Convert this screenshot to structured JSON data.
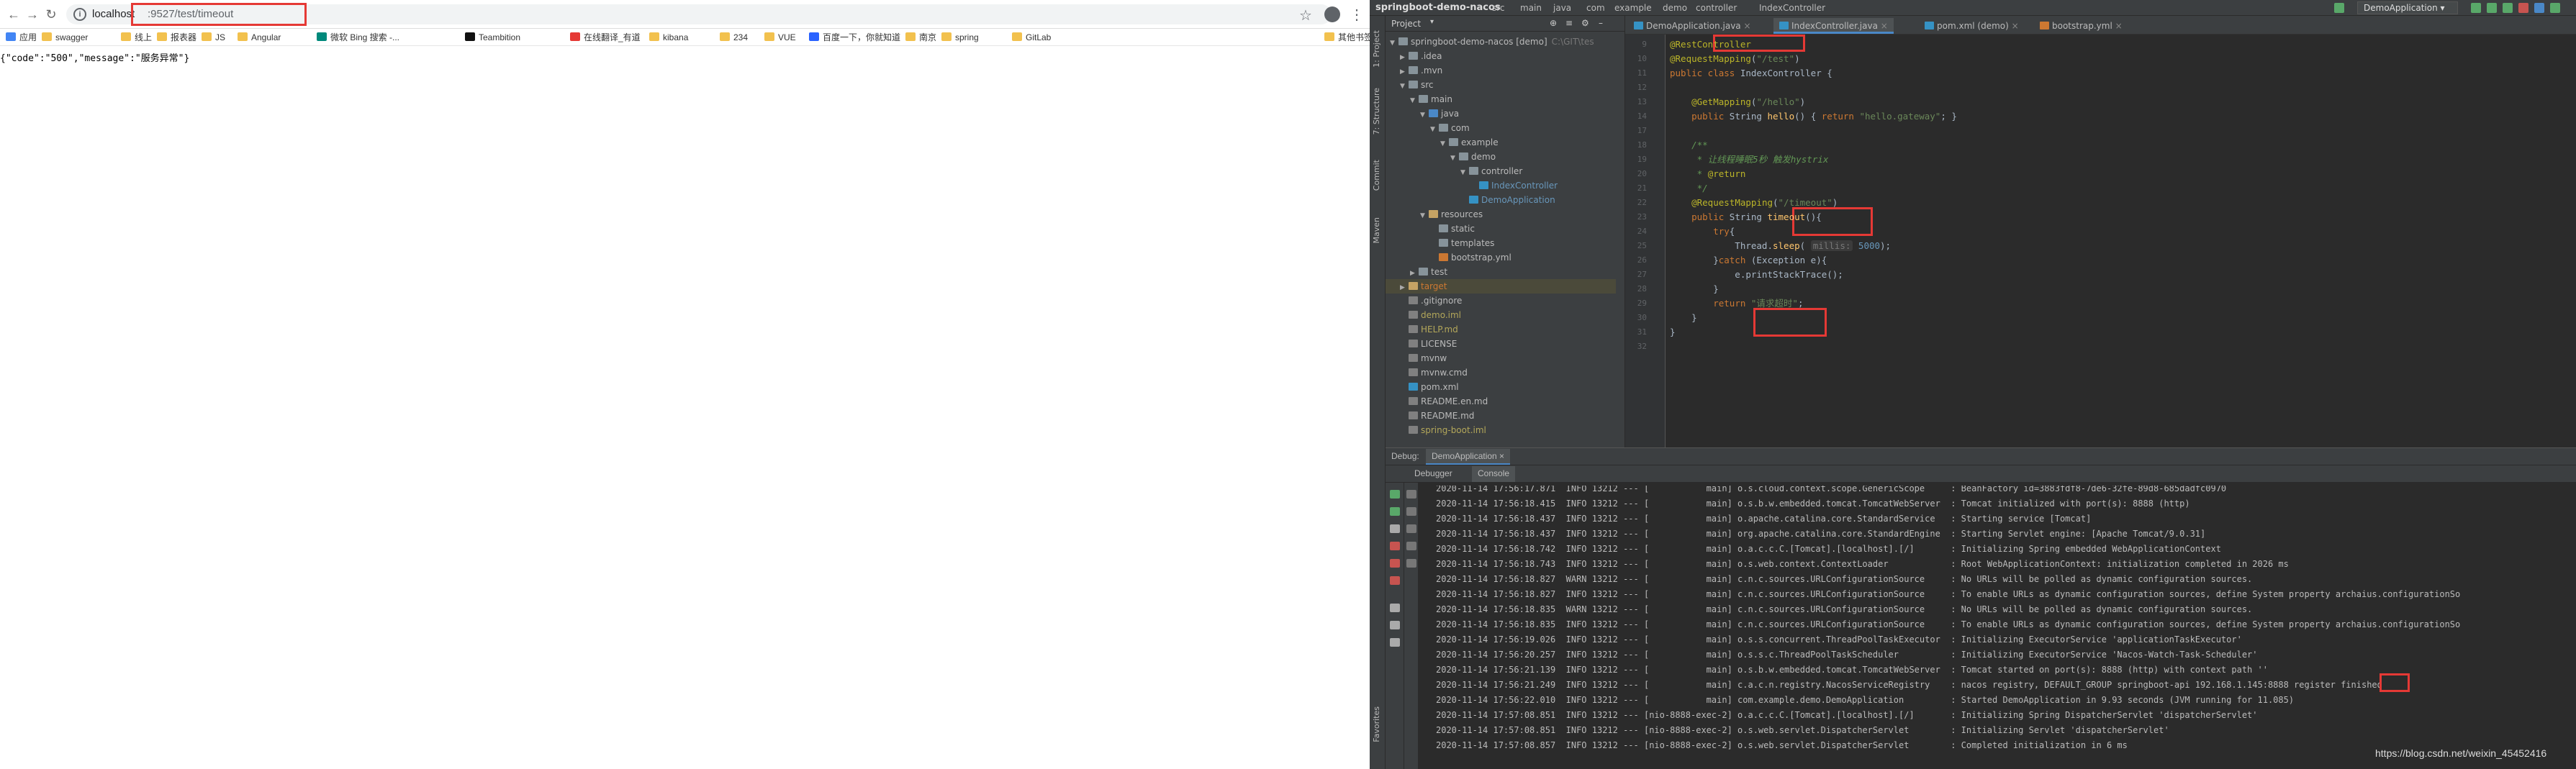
{
  "browser": {
    "url_host": "localhost",
    "url_path": ":9527/test/timeout",
    "bookmarks": [
      {
        "label": "应用",
        "color": "#4285f4"
      },
      {
        "label": "swagger",
        "color": "#f2c14e"
      },
      {
        "label": "线上",
        "color": "#f2c14e"
      },
      {
        "label": "报表器",
        "color": "#f2c14e"
      },
      {
        "label": "JS",
        "color": "#f2c14e"
      },
      {
        "label": "Angular",
        "color": "#f2c14e"
      },
      {
        "label": "微软 Bing 搜索 -...",
        "color": "#00897b"
      },
      {
        "label": "Teambition",
        "color": "#111111"
      },
      {
        "label": "在线翻译_有道",
        "color": "#e53935"
      },
      {
        "label": "kibana",
        "color": "#f2c14e"
      },
      {
        "label": "234",
        "color": "#f2c14e"
      },
      {
        "label": "VUE",
        "color": "#f2c14e"
      },
      {
        "label": "百度一下，你就知道",
        "color": "#2962ff"
      },
      {
        "label": "南京",
        "color": "#f2c14e"
      },
      {
        "label": "spring",
        "color": "#f2c14e"
      },
      {
        "label": "GitLab",
        "color": "#f2c14e"
      },
      {
        "label": "其他书签",
        "color": "#f2c14e"
      }
    ],
    "page_text": "{\"code\":\"500\",\"message\":\"服务异常\"}"
  },
  "ide": {
    "project_name": "springboot-demo-nacos",
    "breadcrumbs": [
      "src",
      "main",
      "java",
      "com",
      "example",
      "demo",
      "controller",
      "IndexController"
    ],
    "run_config": "DemoApplication",
    "project_label": "Project",
    "left_strip": [
      "1: Project",
      "7: Structure",
      "Commit",
      "Maven",
      "Favorites"
    ],
    "tree": [
      {
        "indent": 0,
        "arrow": "▼",
        "label": "springboot-demo-nacos [demo]",
        "suffix": "C:\\GIT\\tes",
        "color": "#bbbbbb",
        "icon": "#87939a"
      },
      {
        "indent": 1,
        "arrow": "▶",
        "label": ".idea",
        "color": "#bbbbbb",
        "icon": "#87939a"
      },
      {
        "indent": 1,
        "arrow": "▶",
        "label": ".mvn",
        "color": "#bbbbbb",
        "icon": "#87939a"
      },
      {
        "indent": 1,
        "arrow": "▼",
        "label": "src",
        "color": "#bbbbbb",
        "icon": "#87939a"
      },
      {
        "indent": 2,
        "arrow": "▼",
        "label": "main",
        "color": "#bbbbbb",
        "icon": "#87939a"
      },
      {
        "indent": 3,
        "arrow": "▼",
        "label": "java",
        "color": "#bbbbbb",
        "icon": "#4a88c7"
      },
      {
        "indent": 4,
        "arrow": "▼",
        "label": "com",
        "color": "#bbbbbb",
        "icon": "#87939a"
      },
      {
        "indent": 5,
        "arrow": "▼",
        "label": "example",
        "color": "#bbbbbb",
        "icon": "#87939a"
      },
      {
        "indent": 6,
        "arrow": "▼",
        "label": "demo",
        "color": "#bbbbbb",
        "icon": "#87939a"
      },
      {
        "indent": 7,
        "arrow": "▼",
        "label": "controller",
        "color": "#bbbbbb",
        "icon": "#87939a"
      },
      {
        "indent": 8,
        "arrow": "",
        "label": "IndexController",
        "color": "#6897bb",
        "icon": "#3592c4"
      },
      {
        "indent": 7,
        "arrow": "",
        "label": "DemoApplication",
        "color": "#6897bb",
        "icon": "#3592c4"
      },
      {
        "indent": 3,
        "arrow": "▼",
        "label": "resources",
        "color": "#bbbbbb",
        "icon": "#c5a364"
      },
      {
        "indent": 4,
        "arrow": "",
        "label": "static",
        "color": "#bbbbbb",
        "icon": "#87939a"
      },
      {
        "indent": 4,
        "arrow": "",
        "label": "templates",
        "color": "#bbbbbb",
        "icon": "#87939a"
      },
      {
        "indent": 4,
        "arrow": "",
        "label": "bootstrap.yml",
        "color": "#bbbbbb",
        "icon": "#cc7832"
      },
      {
        "indent": 2,
        "arrow": "▶",
        "label": "test",
        "color": "#bbbbbb",
        "icon": "#87939a"
      },
      {
        "indent": 1,
        "arrow": "▶",
        "label": "target",
        "color": "#cc7832",
        "icon": "#c5a364",
        "selected": true
      },
      {
        "indent": 1,
        "arrow": "",
        "label": ".gitignore",
        "color": "#bbbbbb",
        "icon": "#808080"
      },
      {
        "indent": 1,
        "arrow": "",
        "label": "demo.iml",
        "color": "#b3a75a",
        "icon": "#808080"
      },
      {
        "indent": 1,
        "arrow": "",
        "label": "HELP.md",
        "color": "#b3a75a",
        "icon": "#808080"
      },
      {
        "indent": 1,
        "arrow": "",
        "label": "LICENSE",
        "color": "#bbbbbb",
        "icon": "#808080"
      },
      {
        "indent": 1,
        "arrow": "",
        "label": "mvnw",
        "color": "#bbbbbb",
        "icon": "#808080"
      },
      {
        "indent": 1,
        "arrow": "",
        "label": "mvnw.cmd",
        "color": "#bbbbbb",
        "icon": "#808080"
      },
      {
        "indent": 1,
        "arrow": "",
        "label": "pom.xml",
        "color": "#bbbbbb",
        "icon": "#3592c4"
      },
      {
        "indent": 1,
        "arrow": "",
        "label": "README.en.md",
        "color": "#bbbbbb",
        "icon": "#808080"
      },
      {
        "indent": 1,
        "arrow": "",
        "label": "README.md",
        "color": "#bbbbbb",
        "icon": "#808080"
      },
      {
        "indent": 1,
        "arrow": "",
        "label": "spring-boot.iml",
        "color": "#b3a75a",
        "icon": "#808080"
      }
    ],
    "tabs": [
      {
        "label": "DemoApplication.java",
        "active": false
      },
      {
        "label": "IndexController.java",
        "active": true
      },
      {
        "label": "pom.xml (demo)",
        "active": false
      },
      {
        "label": "bootstrap.yml",
        "active": false
      }
    ],
    "code_lines": [
      {
        "n": "9",
        "segs": [
          [
            "an",
            "@RestController"
          ]
        ]
      },
      {
        "n": "10",
        "segs": [
          [
            "an",
            "@RequestMapping"
          ],
          [
            "df",
            "("
          ],
          [
            "st",
            "\"/test\""
          ],
          [
            "df",
            ")"
          ]
        ]
      },
      {
        "n": "11",
        "segs": [
          [
            "kw",
            "public class "
          ],
          [
            "df",
            "IndexController {"
          ]
        ]
      },
      {
        "n": "12",
        "segs": []
      },
      {
        "n": "13",
        "segs": [
          [
            "df",
            "    "
          ],
          [
            "an",
            "@GetMapping"
          ],
          [
            "df",
            "("
          ],
          [
            "st",
            "\"/hello\""
          ],
          [
            "df",
            ")"
          ]
        ]
      },
      {
        "n": "14",
        "segs": [
          [
            "df",
            "    "
          ],
          [
            "kw",
            "public "
          ],
          [
            "df",
            "String "
          ],
          [
            "fn",
            "hello"
          ],
          [
            "df",
            "() { "
          ],
          [
            "kw",
            "return "
          ],
          [
            "st",
            "\"hello.gateway\""
          ],
          [
            "df",
            "; }"
          ]
        ]
      },
      {
        "n": "17",
        "segs": []
      },
      {
        "n": "18",
        "segs": [
          [
            "cm",
            "    /**"
          ]
        ]
      },
      {
        "n": "19",
        "segs": [
          [
            "cm",
            "     * 让线程睡眠5秒 触发hystrix"
          ]
        ]
      },
      {
        "n": "20",
        "segs": [
          [
            "cm",
            "     * "
          ],
          [
            "an",
            "@return"
          ]
        ]
      },
      {
        "n": "21",
        "segs": [
          [
            "cm",
            "     */"
          ]
        ]
      },
      {
        "n": "22",
        "segs": [
          [
            "df",
            "    "
          ],
          [
            "an",
            "@RequestMapping"
          ],
          [
            "df",
            "("
          ],
          [
            "st",
            "\"/timeout\""
          ],
          [
            "df",
            ")"
          ]
        ]
      },
      {
        "n": "23",
        "segs": [
          [
            "df",
            "    "
          ],
          [
            "kw",
            "public "
          ],
          [
            "df",
            "String "
          ],
          [
            "fn",
            "timeout"
          ],
          [
            "df",
            "(){"
          ]
        ]
      },
      {
        "n": "24",
        "segs": [
          [
            "df",
            "        "
          ],
          [
            "kw",
            "try"
          ],
          [
            "df",
            "{"
          ]
        ]
      },
      {
        "n": "25",
        "segs": [
          [
            "df",
            "            Thread."
          ],
          [
            "fn",
            "sleep"
          ],
          [
            "df",
            "( "
          ],
          [
            "hint",
            "millis:"
          ],
          [
            "num",
            " 5000"
          ],
          [
            "df",
            ");"
          ]
        ]
      },
      {
        "n": "26",
        "segs": [
          [
            "df",
            "        }"
          ],
          [
            "kw",
            "catch "
          ],
          [
            "df",
            "(Exception e){"
          ]
        ]
      },
      {
        "n": "27",
        "segs": [
          [
            "df",
            "            e.printStackTrace();"
          ]
        ]
      },
      {
        "n": "28",
        "segs": [
          [
            "df",
            "        }"
          ]
        ]
      },
      {
        "n": "29",
        "segs": [
          [
            "df",
            "        "
          ],
          [
            "kw",
            "return "
          ],
          [
            "st",
            "\"请求超时\""
          ],
          [
            "df",
            ";"
          ]
        ]
      },
      {
        "n": "30",
        "segs": [
          [
            "df",
            "    }"
          ]
        ]
      },
      {
        "n": "31",
        "segs": [
          [
            "df",
            "}"
          ]
        ]
      },
      {
        "n": "32",
        "segs": []
      }
    ],
    "debug_head": [
      "Debug:",
      "DemoApplication"
    ],
    "debug_tabs": [
      "Debugger",
      "Console"
    ],
    "logs": [
      "2020-11-14 17:56:17.871  INFO 13212 --- [           main] o.s.cloud.context.scope.GenericScope     : BeanFactory id=3883fdf8-7de6-32fe-89d8-685dadfc0970",
      "2020-11-14 17:56:18.415  INFO 13212 --- [           main] o.s.b.w.embedded.tomcat.TomcatWebServer  : Tomcat initialized with port(s): 8888 (http)",
      "2020-11-14 17:56:18.437  INFO 13212 --- [           main] o.apache.catalina.core.StandardService   : Starting service [Tomcat]",
      "2020-11-14 17:56:18.437  INFO 13212 --- [           main] org.apache.catalina.core.StandardEngine  : Starting Servlet engine: [Apache Tomcat/9.0.31]",
      "2020-11-14 17:56:18.742  INFO 13212 --- [           main] o.a.c.c.C.[Tomcat].[localhost].[/]       : Initializing Spring embedded WebApplicationContext",
      "2020-11-14 17:56:18.743  INFO 13212 --- [           main] o.s.web.context.ContextLoader            : Root WebApplicationContext: initialization completed in 2026 ms",
      "2020-11-14 17:56:18.827  WARN 13212 --- [           main] c.n.c.sources.URLConfigurationSource     : No URLs will be polled as dynamic configuration sources.",
      "2020-11-14 17:56:18.827  INFO 13212 --- [           main] c.n.c.sources.URLConfigurationSource     : To enable URLs as dynamic configuration sources, define System property archaius.configurationSo",
      "2020-11-14 17:56:18.835  WARN 13212 --- [           main] c.n.c.sources.URLConfigurationSource     : No URLs will be polled as dynamic configuration sources.",
      "2020-11-14 17:56:18.835  INFO 13212 --- [           main] c.n.c.sources.URLConfigurationSource     : To enable URLs as dynamic configuration sources, define System property archaius.configurationSo",
      "2020-11-14 17:56:19.026  INFO 13212 --- [           main] o.s.s.concurrent.ThreadPoolTaskExecutor  : Initializing ExecutorService 'applicationTaskExecutor'",
      "2020-11-14 17:56:20.257  INFO 13212 --- [           main] o.s.s.c.ThreadPoolTaskScheduler          : Initializing ExecutorService 'Nacos-Watch-Task-Scheduler'",
      "2020-11-14 17:56:21.139  INFO 13212 --- [           main] o.s.b.w.embedded.tomcat.TomcatWebServer  : Tomcat started on port(s): 8888 (http) with context path ''",
      "2020-11-14 17:56:21.249  INFO 13212 --- [           main] c.a.c.n.registry.NacosServiceRegistry    : nacos registry, DEFAULT_GROUP springboot-api 192.168.1.145:8888 register finished",
      "2020-11-14 17:56:22.010  INFO 13212 --- [           main] com.example.demo.DemoApplication         : Started DemoApplication in 9.93 seconds (JVM running for 11.085)",
      "2020-11-14 17:57:08.851  INFO 13212 --- [nio-8888-exec-2] o.a.c.c.C.[Tomcat].[localhost].[/]       : Initializing Spring DispatcherServlet 'dispatcherServlet'",
      "2020-11-14 17:57:08.851  INFO 13212 --- [nio-8888-exec-2] o.s.web.servlet.DispatcherServlet        : Initializing Servlet 'dispatcherServlet'",
      "2020-11-14 17:57:08.857  INFO 13212 --- [nio-8888-exec-2] o.s.web.servlet.DispatcherServlet        : Completed initialization in 6 ms"
    ]
  },
  "watermark": "https://blog.csdn.net/weixin_45452416"
}
